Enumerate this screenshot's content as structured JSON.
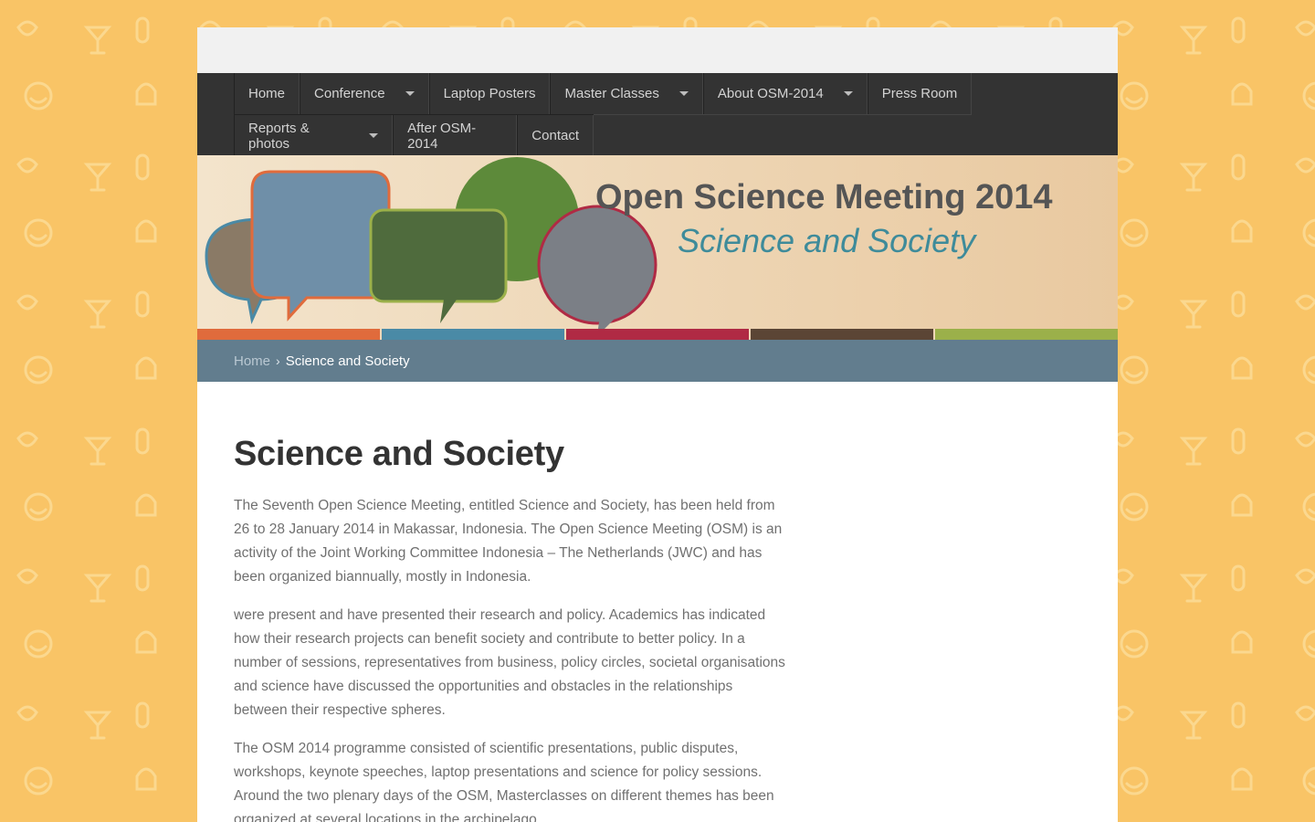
{
  "nav": {
    "row1": [
      {
        "label": "Home",
        "has_dropdown": false
      },
      {
        "label": "Conference",
        "has_dropdown": true
      },
      {
        "label": "Laptop Posters",
        "has_dropdown": false
      },
      {
        "label": "Master Classes",
        "has_dropdown": true
      },
      {
        "label": "About OSM-2014",
        "has_dropdown": true
      },
      {
        "label": "Press Room",
        "has_dropdown": false
      }
    ],
    "row2": [
      {
        "label": "Reports & photos",
        "has_dropdown": true
      },
      {
        "label": "After OSM-2014",
        "has_dropdown": false
      },
      {
        "label": "Contact",
        "has_dropdown": false
      }
    ]
  },
  "banner": {
    "title": "Open Science Meeting 2014",
    "subtitle": "Science and Society",
    "stripe_colors": [
      "#e06b3c",
      "#4a8aa6",
      "#b02a44",
      "#5b4535",
      "#9bb04a"
    ]
  },
  "breadcrumb": {
    "home": "Home",
    "separator": "›",
    "current": "Science and Society"
  },
  "article": {
    "title": "Science and Society",
    "paragraphs": [
      "The Seventh Open Science Meeting, entitled Science and Society, has been held from 26 to 28 January 2014 in Makassar, Indonesia. The Open Science Meeting (OSM) is an activity of the Joint Working Committee Indonesia – The Netherlands (JWC) and has been organized biannually, mostly in Indonesia.",
      "were present and have presented their research and policy. Academics has indicated how their research projects can benefit society and contribute to better policy. In a number of sessions, representatives from business, policy circles, societal organisations and science have discussed the opportunities and obstacles in the relationships between their respective spheres.",
      "The OSM 2014 programme consisted of scientific presentations, public disputes, workshops, keynote speeches, laptop presentations and science for policy sessions. Around the two plenary days of the OSM, Masterclasses on different themes has been organized at several locations in the archipelago."
    ]
  },
  "colors": {
    "page_background": "#f9c466",
    "nav_background": "#333333",
    "breadcrumb_background": "#627d8e",
    "title_color": "#333333",
    "body_text": "#707070"
  }
}
